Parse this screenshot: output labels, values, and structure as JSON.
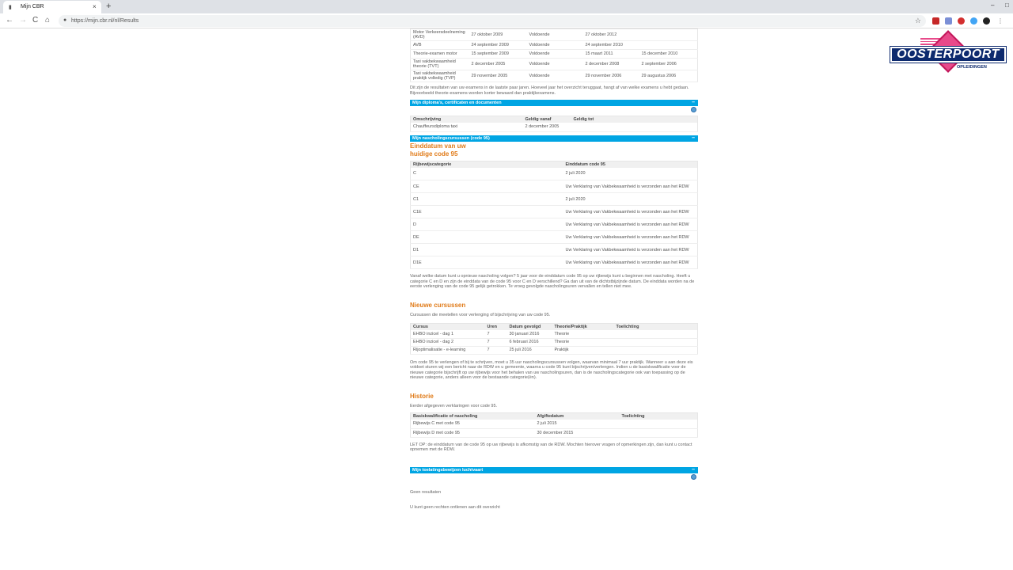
{
  "browser": {
    "tab_title": "Mijn CBR",
    "url": "https://mijn.cbr.nl/nl/Results",
    "new_tab": "+",
    "close": "×",
    "back": "←",
    "forward": "→",
    "reload": "C",
    "home": "⌂",
    "min": "–",
    "max": "□",
    "winclose": "✕"
  },
  "logo": {
    "name": "OOSTERPOORT",
    "sub": "OPLEIDINGEN"
  },
  "exams": {
    "rows": [
      [
        "Motor Verkeersdeelneming (AVD)",
        "27 oktober 2009",
        "Voldoende",
        "27 oktober 2012",
        ""
      ],
      [
        "AVB",
        "24 september 2009",
        "Voldoende",
        "24 september 2010",
        ""
      ],
      [
        "Theorie-examen motor",
        "15 september 2009",
        "Voldoende",
        "15 maart 2011",
        "15 december 2010"
      ],
      [
        "Taxi vakbekwaamheid theorie (TVT)",
        "2 december 2005",
        "Voldoende",
        "2 december 2008",
        "2 september 2006"
      ],
      [
        "Taxi vakbekwaamheid praktijk volledig (TVP)",
        "29 november 2005",
        "Voldoende",
        "29 november 2006",
        "29 augustus 2006"
      ]
    ],
    "note": "Dit zijn de resultaten van uw examens in de laatste paar jaren. Hoeveel jaar het overzicht teruggaat, hangt af van welke examens u hebt gedaan. Bijvoorbeeld theorie-examens worden korter bewaard dan praktijkexamens."
  },
  "diplomas": {
    "bar": "Mijn diploma's, certificaten en documenten",
    "headers": [
      "Omschrijving",
      "Geldig vanaf",
      "Geldig tot"
    ],
    "rows": [
      [
        "Chauffeursdiploma taxi",
        "2 december 2005",
        ""
      ]
    ]
  },
  "code95": {
    "bar": "Mijn nascholingscursussen (code 95)",
    "title_1": "Einddatum van uw",
    "title_2": "huidige code 95",
    "headers": [
      "Rijbewijscategorie",
      "Einddatum code 95"
    ],
    "rows": [
      [
        "C",
        "2 juli 2020"
      ],
      [
        "CE",
        "Uw Verklaring van Vakbekwaamheid is verzonden aan het RDW"
      ],
      [
        "C1",
        "2 juli 2020"
      ],
      [
        "C1E",
        "Uw Verklaring van Vakbekwaamheid is verzonden aan het RDW"
      ],
      [
        "D",
        "Uw Verklaring van Vakbekwaamheid is verzonden aan het RDW"
      ],
      [
        "DE",
        "Uw Verklaring van Vakbekwaamheid is verzonden aan het RDW"
      ],
      [
        "D1",
        "Uw Verklaring van Vakbekwaamheid is verzonden aan het RDW"
      ],
      [
        "D1E",
        "Uw Verklaring van Vakbekwaamheid is verzonden aan het RDW"
      ]
    ],
    "note": "Vanaf welke datum kunt u opnieuw nascholing volgen? 5 jaar voor de einddatum code 95 op uw rijbewijs kunt u beginnen met nascholing. Heeft u categorie C en D en zijn de einddata van de code 95 voor C en D verschillend? Ga dan uit van de dichtstbijzijnde datum. De einddata worden na de eerste verlenging van de code 95 gelijk getrokken. Te vroeg gevolgde nascholingsuren vervallen en tellen niet mee."
  },
  "courses": {
    "title": "Nieuwe cursussen",
    "intro": "Cursussen die meetellen voor verlenging of bijschrijving van uw code 95.",
    "headers": [
      "Cursus",
      "Uren",
      "Datum gevolgd",
      "Theorie/Praktijk",
      "Toelichting"
    ],
    "rows": [
      [
        "EHBO inzicel - dag 1",
        "7",
        "30 januari 2016",
        "Theorie",
        ""
      ],
      [
        "EHBO inzicel - dag 2",
        "7",
        "6 februari 2016",
        "Theorie",
        ""
      ],
      [
        "Rijoptimalisatie - e-learning",
        "7",
        "25 juli 2016",
        "Praktijk",
        ""
      ]
    ],
    "note": "Om code 95 te verlengen of bij te schrijven, moet u 35 uur nascholingscursussen volgen, waarvan minimaal 7 uur praktijk. Wanneer u aan deze eis voldoet sturen wij een bericht naar de RDW en u gemeente, waarna u code 95 kunt bijschrijven/verlengen. Indien u de basiskwalificatie voor de nieuwe categorie bijschrijft op uw rijbewijs voor het behalen van uw nascholingsuren, dan is de nascholingscategorie ook van toepassing op de nieuwe categorie, anders alleen voor de bestaande categorie(ën)."
  },
  "history": {
    "title": "Historie",
    "intro": "Eerder afgegeven verklaringen voor code 95.",
    "headers": [
      "Basiskwalificatie of nascholing",
      "Afgiftedatum",
      "Toelichting"
    ],
    "rows": [
      [
        "Rijbewijs C met code 95",
        "2 juli 2015",
        ""
      ],
      [
        "Rijbewijs D met code 95",
        "30 december 2015",
        ""
      ]
    ],
    "note": "LET OP: de einddatum van de code 95 op uw rijbewijs is afkomstig van de RDW. Mochten hierover vragen of opmerkingen zijn, dan kunt u contact opnemen met de RDW."
  },
  "toelating": {
    "bar": "Mijn toelatingsbewijzen luchtvaart",
    "empty": "Geen resultaten",
    "footer": "U kunt geen rechten ontlenen aan dit overzicht"
  },
  "colors": {
    "bar": "#00a5e3",
    "heading": "#e07b19"
  }
}
